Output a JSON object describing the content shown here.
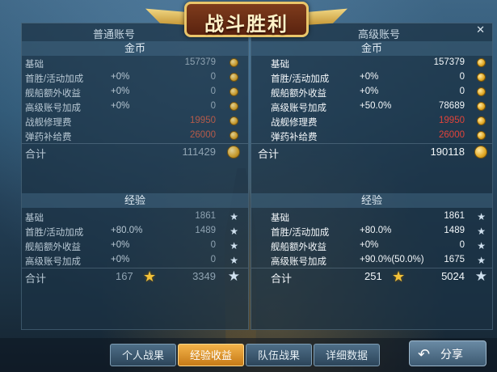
{
  "banner_title": "战斗胜利",
  "close_label": "✕",
  "left": {
    "account_title": "普通账号",
    "gold": {
      "header": "金币",
      "rows": [
        {
          "label": "基础",
          "pct": "",
          "value": "157379"
        },
        {
          "label": "首胜/活动加成",
          "pct": "+0%",
          "value": "0"
        },
        {
          "label": "舰船额外收益",
          "pct": "+0%",
          "value": "0"
        },
        {
          "label": "高级账号加成",
          "pct": "+0%",
          "value": "0"
        },
        {
          "label": "战舰修理费",
          "pct": "",
          "value": "19950"
        },
        {
          "label": "弹药补给费",
          "pct": "",
          "value": "26000"
        }
      ],
      "total_label": "合计",
      "total_value": "111429"
    },
    "exp": {
      "header": "经验",
      "rows": [
        {
          "label": "基础",
          "pct": "",
          "value": "1861"
        },
        {
          "label": "首胜/活动加成",
          "pct": "+80.0%",
          "value": "1489"
        },
        {
          "label": "舰船额外收益",
          "pct": "+0%",
          "value": "0"
        },
        {
          "label": "高级账号加成",
          "pct": "+0%",
          "value": "0"
        }
      ],
      "total_label": "合计",
      "total_mid": "167",
      "total_value": "3349"
    }
  },
  "right": {
    "account_title": "高级账号",
    "gold": {
      "header": "金币",
      "rows": [
        {
          "label": "基础",
          "pct": "",
          "value": "157379"
        },
        {
          "label": "首胜/活动加成",
          "pct": "+0%",
          "value": "0"
        },
        {
          "label": "舰船额外收益",
          "pct": "+0%",
          "value": "0"
        },
        {
          "label": "高级账号加成",
          "pct": "+50.0%",
          "value": "78689"
        },
        {
          "label": "战舰修理费",
          "pct": "",
          "value": "19950"
        },
        {
          "label": "弹药补给费",
          "pct": "",
          "value": "26000"
        }
      ],
      "total_label": "合计",
      "total_value": "190118"
    },
    "exp": {
      "header": "经验",
      "rows": [
        {
          "label": "基础",
          "pct": "",
          "value": "1861"
        },
        {
          "label": "首胜/活动加成",
          "pct": "+80.0%",
          "value": "1489"
        },
        {
          "label": "舰船额外收益",
          "pct": "+0%",
          "value": "0"
        },
        {
          "label": "高级账号加成",
          "pct": "+90.0%(50.0%)",
          "value": "1675"
        }
      ],
      "total_label": "合计",
      "total_mid": "251",
      "total_value": "5024"
    }
  },
  "tabs": [
    {
      "label": "个人战果",
      "active": false
    },
    {
      "label": "经验收益",
      "active": true
    },
    {
      "label": "队伍战果",
      "active": false
    },
    {
      "label": "详细数据",
      "active": false
    }
  ],
  "share_label": "分享",
  "colors": {
    "cost_red": "#e0433a",
    "gold": "#e1a825",
    "active_tab": "#e89a2c"
  },
  "icons": {
    "coin": "coin-icon",
    "star": "star-icon",
    "share": "share-arrow-icon",
    "close": "close-icon"
  }
}
